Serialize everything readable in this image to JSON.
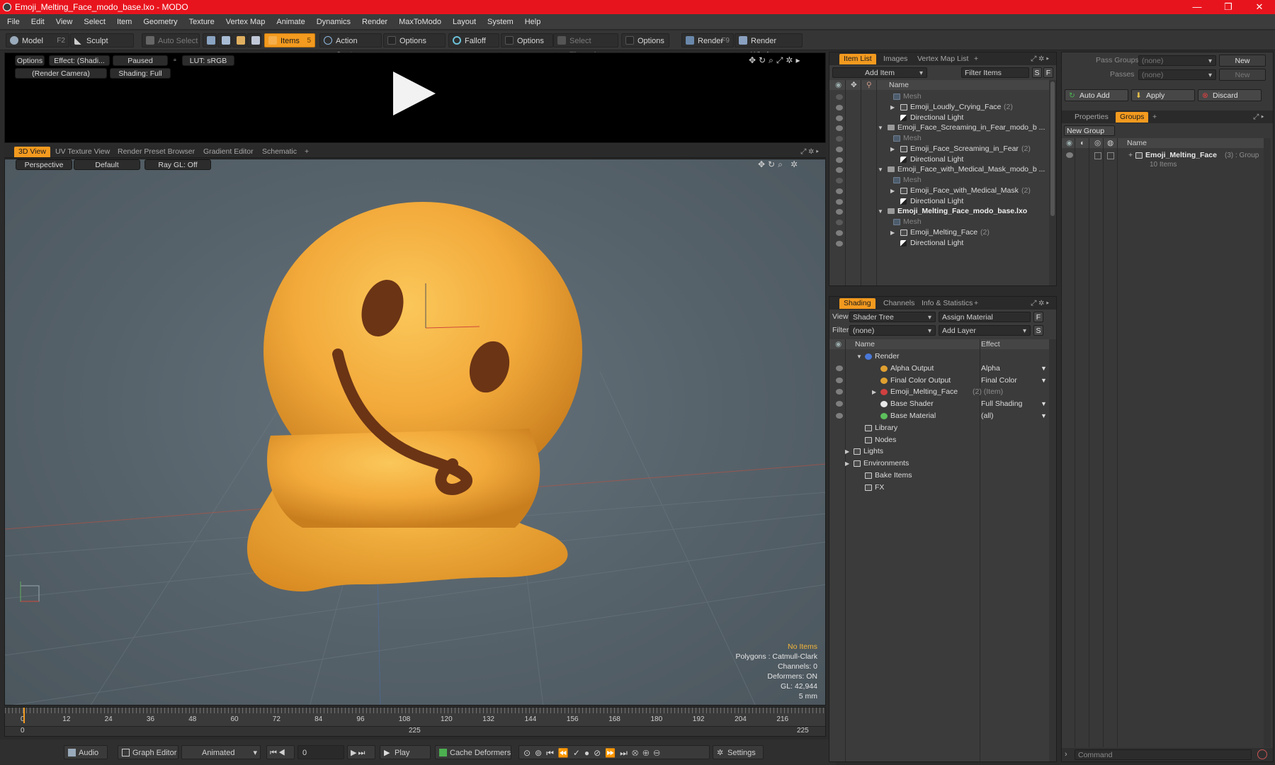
{
  "window": {
    "title": "Emoji_Melting_Face_modo_base.lxo - MODO",
    "minimize": "—",
    "maximize": "❐",
    "close": "✕"
  },
  "menu": [
    "File",
    "Edit",
    "View",
    "Select",
    "Item",
    "Geometry",
    "Texture",
    "Vertex Map",
    "Animate",
    "Dynamics",
    "Render",
    "MaxToModo",
    "Layout",
    "System",
    "Help"
  ],
  "toolbar": {
    "model": "Model",
    "model_key": "F2",
    "sculpt": "Sculpt",
    "auto_select": "Auto Select",
    "items": "Items",
    "items_key": "5",
    "action_center": "Action Center",
    "options1": "Options",
    "falloff": "Falloff",
    "options2": "Options",
    "select_through": "Select Through",
    "options3": "Options",
    "render": "Render",
    "render_key": "F9",
    "render_window": "Render Window"
  },
  "render_preview": {
    "options": "Options",
    "effect": "Effect: (Shadi...",
    "paused": "Paused",
    "lut": "LUT: sRGB",
    "camera": "(Render Camera)",
    "shading": "Shading: Full"
  },
  "viewport_tabs": [
    "3D View",
    "UV Texture View",
    "Render Preset Browser",
    "Gradient Editor",
    "Schematic",
    "+"
  ],
  "viewport": {
    "perspective": "Perspective",
    "default": "Default",
    "raygl": "Ray GL: Off",
    "hud": [
      "No Items",
      "Polygons : Catmull-Clark",
      "Channels: 0",
      "Deformers: ON",
      "GL: 42,944",
      "5 mm"
    ]
  },
  "timeline": {
    "ticks": [
      "0",
      "12",
      "24",
      "36",
      "48",
      "60",
      "72",
      "84",
      "96",
      "108",
      "120",
      "132",
      "144",
      "156",
      "168",
      "180",
      "192",
      "204",
      "216"
    ],
    "start": "0",
    "mid": "225",
    "end": "225"
  },
  "transport": {
    "audio": "Audio",
    "graph_editor": "Graph Editor",
    "animated": "Animated",
    "frame": "0",
    "play": "Play",
    "cache_deformers": "Cache Deformers",
    "settings": "Settings"
  },
  "item_list": {
    "tabs": [
      "Item List",
      "Images",
      "Vertex Map List",
      "+"
    ],
    "add_item": "Add Item",
    "filter_items": "Filter Items",
    "s": "S",
    "f": "F",
    "col_name": "Name",
    "rows": [
      {
        "label": "Mesh",
        "count": "",
        "dim": true
      },
      {
        "label": "Emoji_Loudly_Crying_Face",
        "count": "(2)",
        "dim": false
      },
      {
        "label": "Directional Light",
        "count": "",
        "dim": false
      },
      {
        "label": "Emoji_Face_Screaming_in_Fear_modo_b ...",
        "count": "",
        "dim": false
      },
      {
        "label": "Mesh",
        "count": "",
        "dim": true
      },
      {
        "label": "Emoji_Face_Screaming_in_Fear",
        "count": "(2)",
        "dim": false
      },
      {
        "label": "Directional Light",
        "count": "",
        "dim": false
      },
      {
        "label": "Emoji_Face_with_Medical_Mask_modo_b ...",
        "count": "",
        "dim": false
      },
      {
        "label": "Mesh",
        "count": "",
        "dim": true
      },
      {
        "label": "Emoji_Face_with_Medical_Mask",
        "count": "(2)",
        "dim": false
      },
      {
        "label": "Directional Light",
        "count": "",
        "dim": false
      },
      {
        "label": "Emoji_Melting_Face_modo_base.lxo",
        "count": "",
        "dim": false
      },
      {
        "label": "Mesh",
        "count": "",
        "dim": true
      },
      {
        "label": "Emoji_Melting_Face",
        "count": "(2)",
        "dim": false
      },
      {
        "label": "Directional Light",
        "count": "",
        "dim": false
      }
    ]
  },
  "shading": {
    "tabs": [
      "Shading",
      "Channels",
      "Info & Statistics",
      "+"
    ],
    "view_label": "View",
    "view_value": "Shader Tree",
    "assign_material": "Assign Material",
    "f": "F",
    "filter_label": "Filter",
    "filter_value": "(none)",
    "add_layer": "Add Layer",
    "s": "S",
    "col_name": "Name",
    "col_effect": "Effect",
    "rows": [
      {
        "label": "Render",
        "effect": "",
        "count": ""
      },
      {
        "label": "Alpha Output",
        "effect": "Alpha",
        "count": ""
      },
      {
        "label": "Final Color Output",
        "effect": "Final Color",
        "count": ""
      },
      {
        "label": "Emoji_Melting_Face",
        "effect": "",
        "count": "(2) (Item)"
      },
      {
        "label": "Base Shader",
        "effect": "Full Shading",
        "count": ""
      },
      {
        "label": "Base Material",
        "effect": "(all)",
        "count": ""
      },
      {
        "label": "Library",
        "effect": "",
        "count": ""
      },
      {
        "label": "Nodes",
        "effect": "",
        "count": ""
      },
      {
        "label": "Lights",
        "effect": "",
        "count": ""
      },
      {
        "label": "Environments",
        "effect": "",
        "count": ""
      },
      {
        "label": "Bake Items",
        "effect": "",
        "count": ""
      },
      {
        "label": "FX",
        "effect": "",
        "count": ""
      }
    ]
  },
  "groups_panel": {
    "pass_groups_label": "Pass Groups",
    "pass_groups_value": "(none)",
    "new1": "New",
    "passes_label": "Passes",
    "passes_value": "(none)",
    "new2": "New",
    "auto_add": "Auto Add",
    "apply": "Apply",
    "discard": "Discard",
    "tabs": [
      "Properties",
      "Groups",
      "+"
    ],
    "new_group": "New Group",
    "col_name": "Name",
    "group_name": "Emoji_Melting_Face",
    "group_count": "(3) : Group",
    "group_items": "10 Items"
  },
  "command": {
    "placeholder": "Command"
  }
}
